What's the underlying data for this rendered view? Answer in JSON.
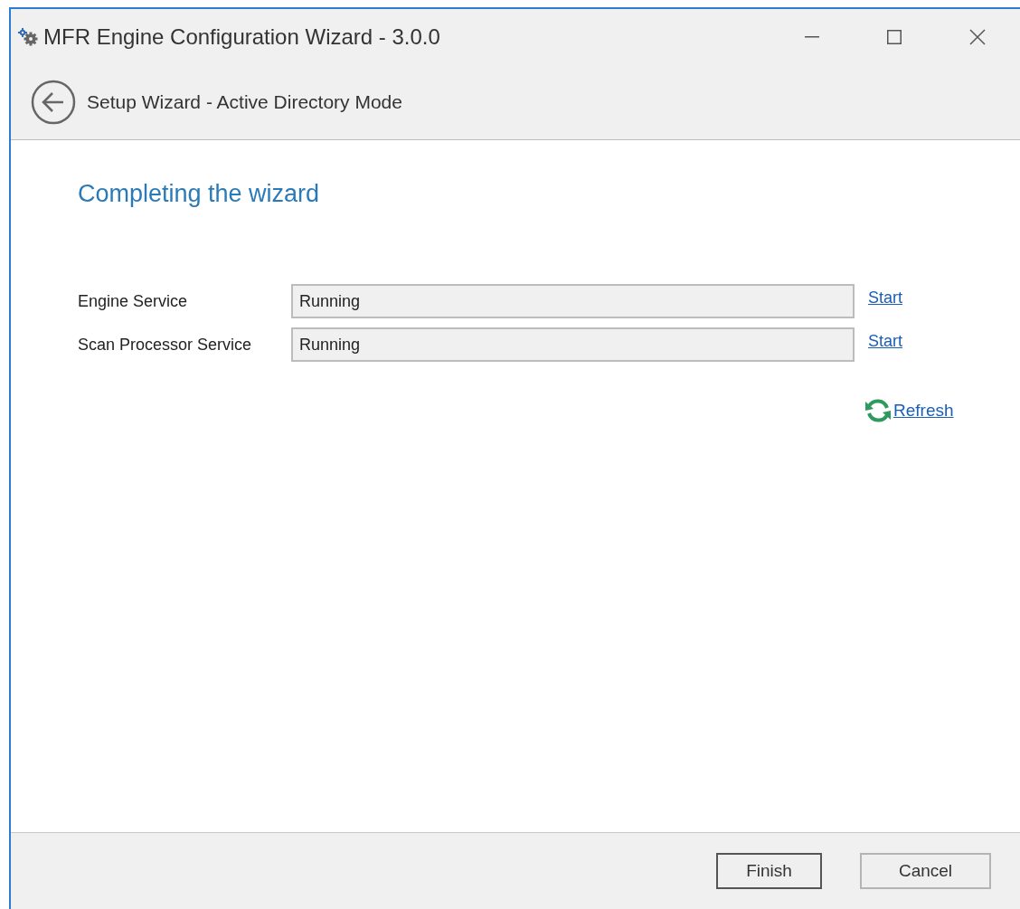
{
  "window": {
    "title": "MFR Engine Configuration Wizard - 3.0.0"
  },
  "nav": {
    "title": "Setup Wizard - Active Directory Mode"
  },
  "heading": "Completing the wizard",
  "services": [
    {
      "label": "Engine Service",
      "value": "Running",
      "action": "Start"
    },
    {
      "label": "Scan Processor Service",
      "value": "Running",
      "action": "Start"
    }
  ],
  "refresh": "Refresh",
  "buttons": [
    {
      "label": "Finish",
      "default": true
    },
    {
      "label": "Cancel",
      "default": false
    }
  ]
}
